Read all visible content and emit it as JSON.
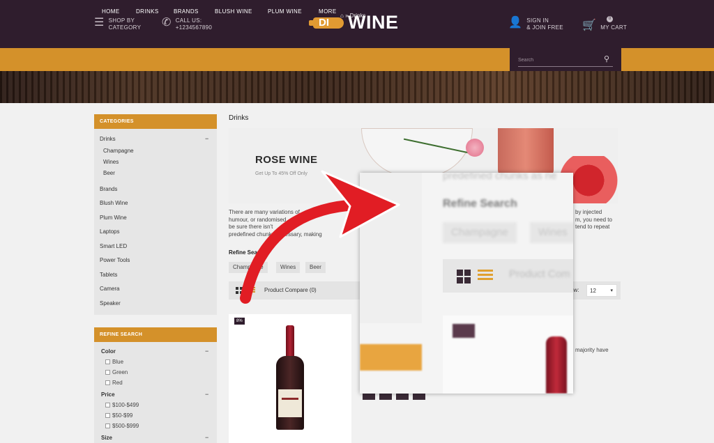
{
  "header": {
    "shop_by": [
      "SHOP BY",
      "CATEGORY"
    ],
    "call_us": [
      "CALL US:",
      "+1234567890"
    ],
    "logo_di": "DI",
    "logo_wine": "WINE",
    "sign_in": [
      "SIGN IN",
      "& JOIN FREE"
    ],
    "cart": [
      "MY CART"
    ],
    "cart_count": "0"
  },
  "nav": {
    "items": [
      "HOME",
      "DRINKS",
      "BRANDS",
      "BLUSH WINE",
      "PLUM WINE",
      "MORE"
    ],
    "search_placeholder": "Search"
  },
  "breadcrumb": {
    "home_icon": "home-icon",
    "separator": "»",
    "current": "Drinks"
  },
  "sidebar": {
    "categories_title": "CATEGORIES",
    "drinks": "Drinks",
    "drinks_sub": [
      "Champagne",
      "Wines",
      "Beer"
    ],
    "links": [
      "Brands",
      "Blush Wine",
      "Plum Wine",
      "Laptops",
      "Smart LED",
      "Power Tools",
      "Tablets",
      "Camera",
      "Speaker"
    ],
    "refine_title": "REFINE SEARCH",
    "color_title": "Color",
    "colors": [
      "Blue",
      "Green",
      "Red"
    ],
    "price_title": "Price",
    "prices": [
      "$100-$499",
      "$50-$99",
      "$500-$999"
    ],
    "size_title": "Size",
    "minus": "−"
  },
  "main": {
    "title": "Drinks",
    "promo_title": "ROSE WINE",
    "promo_sub": "Get Up To 45% Off Only",
    "desc_lines": [
      "There are many variations of",
      "humour, or randomised",
      "be sure there isn't",
      "predefined chunks necessary, making"
    ],
    "desc_right": [
      "by injected",
      "m, you need to",
      "tend to repeat"
    ],
    "refine_label": "Refine Search",
    "chips": [
      "Champagne",
      "Wines",
      "Beer"
    ],
    "compare": "Product Compare (0)",
    "show_label": "ow:",
    "show_value": "12",
    "product_badge": "8%",
    "majority_text": "majority have"
  },
  "zoom": {
    "text_top": "predefined chunks as ne",
    "refine": "Refine Search",
    "chips": [
      "Champagne",
      "Wines"
    ],
    "compare": "Product Com",
    "badge": "8%"
  },
  "colors": {
    "header_bg": "#2f1d2d",
    "accent": "#d4912a",
    "arrow": "#e11d24"
  }
}
